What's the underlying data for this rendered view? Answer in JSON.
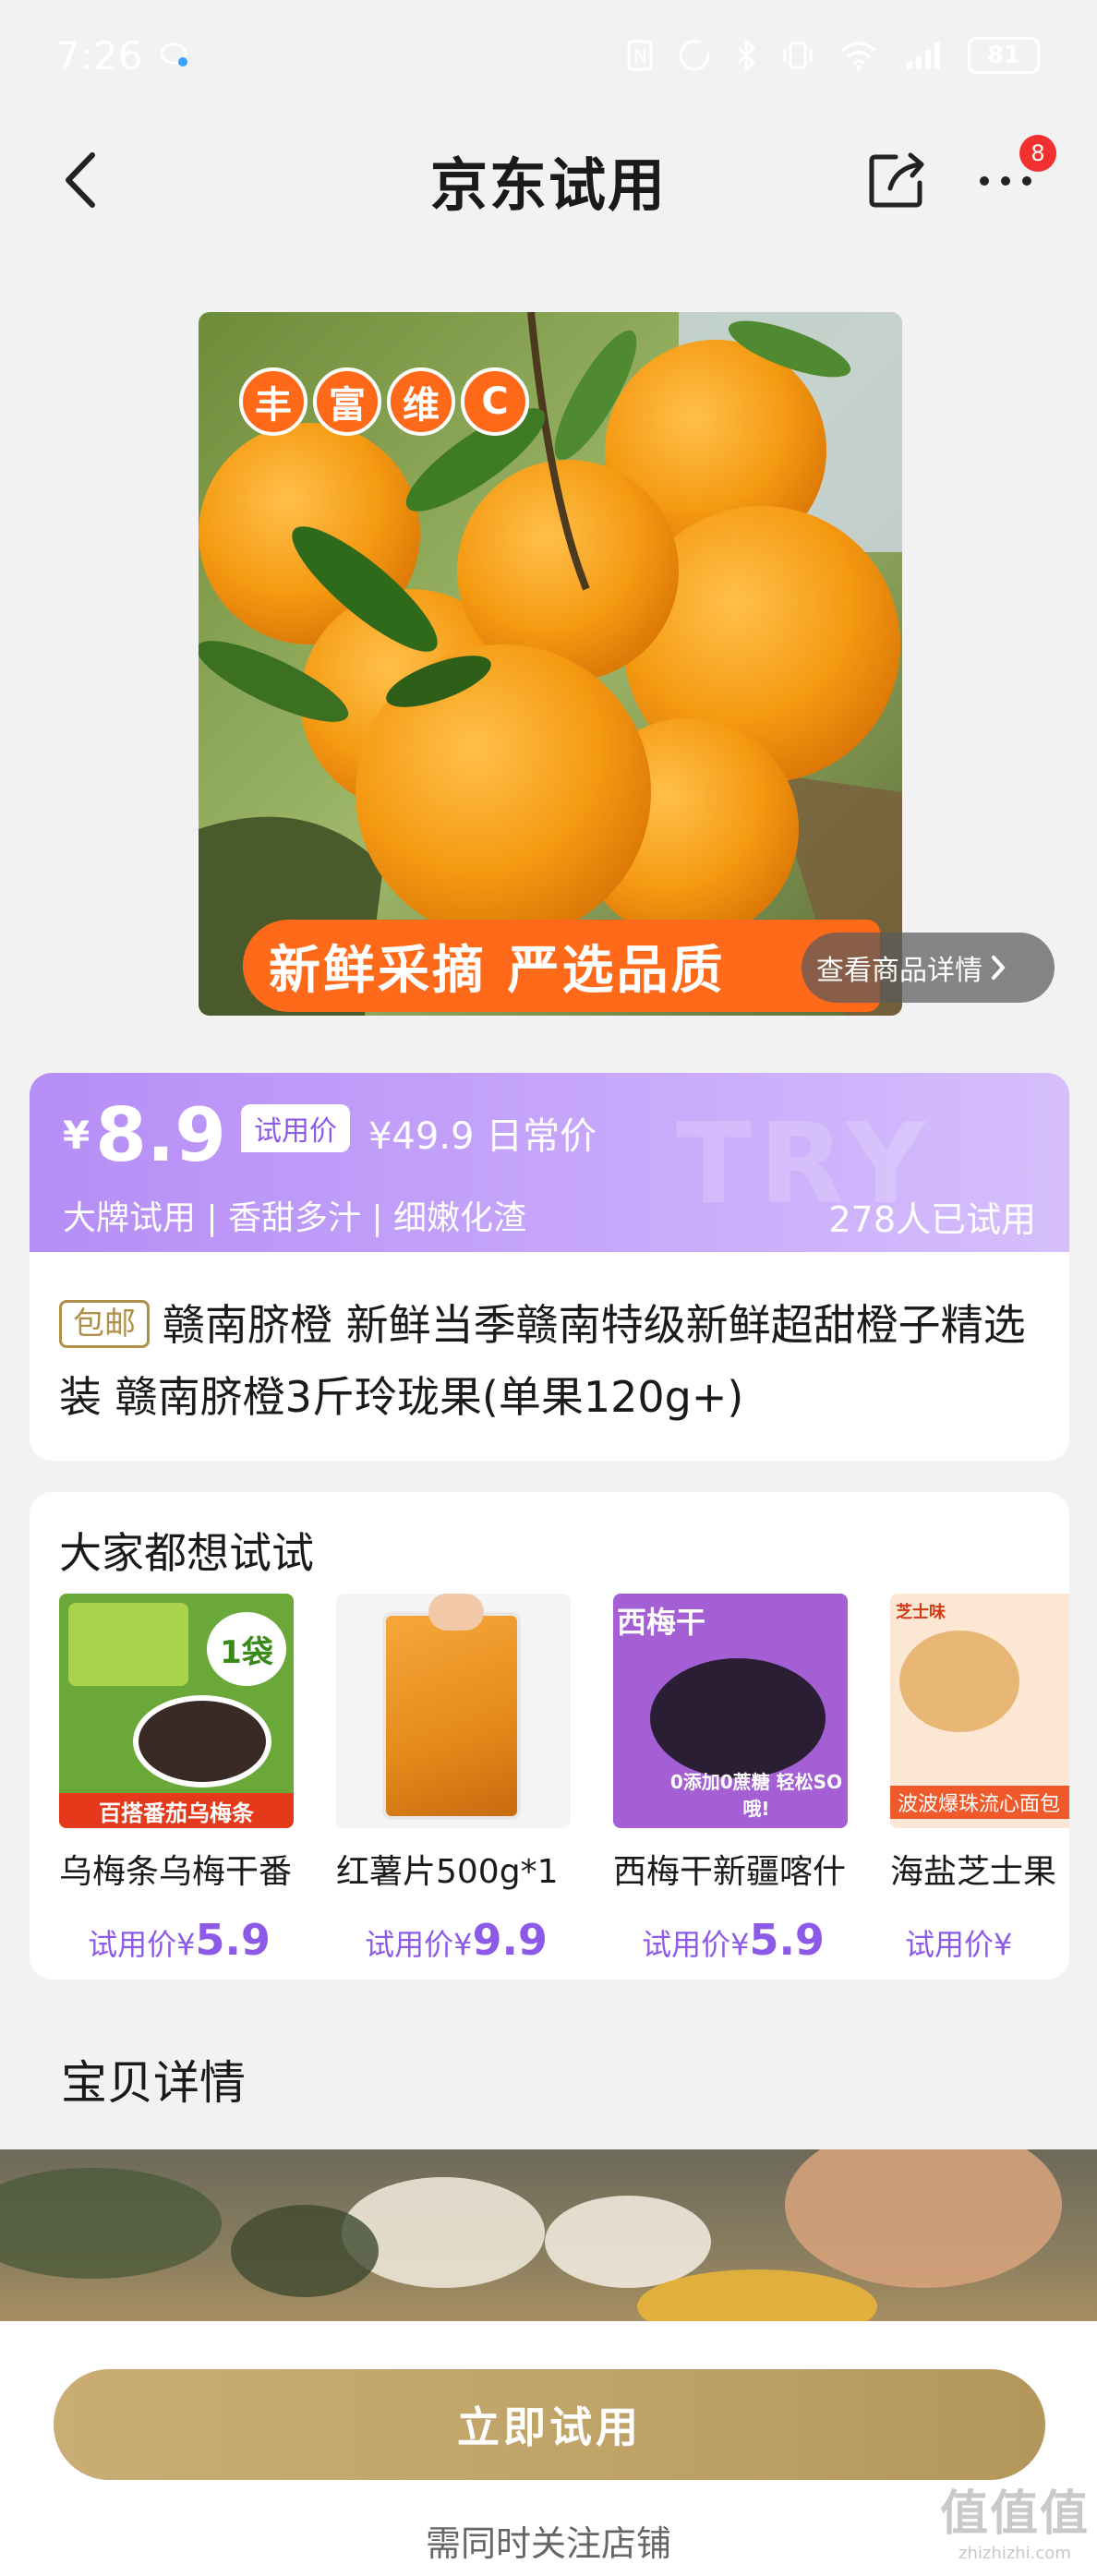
{
  "status_bar": {
    "time": "7:26",
    "battery": "81"
  },
  "nav": {
    "title": "京东试用",
    "badge_count": "8"
  },
  "product_image": {
    "tag_chars": [
      "丰",
      "富",
      "维",
      "C"
    ],
    "banner_text": "新鲜采摘 严选品质",
    "view_detail_label": "查看商品详情"
  },
  "price_card": {
    "currency": "¥",
    "trial_price": "8.9",
    "trial_tag": "试用价",
    "original_price": "¥49.9 日常价",
    "features": "大牌试用 | 香甜多汁 | 细嫩化渣",
    "trial_count": "278人已试用",
    "watermark": "TRY"
  },
  "product": {
    "shipping_tag": "包邮",
    "title": "赣南脐橙 新鲜当季赣南特级新鲜超甜橙子精选装 赣南脐橙3斤玲珑果(单果120g+)"
  },
  "recommendations": {
    "heading": "大家都想试试",
    "price_label": "试用价¥",
    "items": [
      {
        "name": "乌梅条乌梅干番",
        "price": "5.9",
        "img_text_top": "1袋",
        "img_text_bottom": "百搭番茄乌梅条"
      },
      {
        "name": "红薯片500g*1",
        "price": "9.9",
        "img_text_top": "",
        "img_text_bottom": ""
      },
      {
        "name": "西梅干新疆喀什",
        "price": "5.9",
        "img_text_top": "西梅干",
        "img_text_bottom": "0添加0蔗糖 轻松SO哦!"
      },
      {
        "name": "海盐芝士果",
        "price": "",
        "img_text_top": "芝士味",
        "img_text_bottom": "波波爆珠流心面包"
      }
    ]
  },
  "detail_section": {
    "title": "宝贝详情"
  },
  "bottom": {
    "button_label": "立即试用",
    "note": "需同时关注店铺"
  },
  "watermark": {
    "big": "值值值",
    "small": "zhizhizhi.com"
  },
  "colors": {
    "accent_purple": "#8d5ae8",
    "gold": "#c8ad74",
    "orange": "#ff6a1a"
  }
}
